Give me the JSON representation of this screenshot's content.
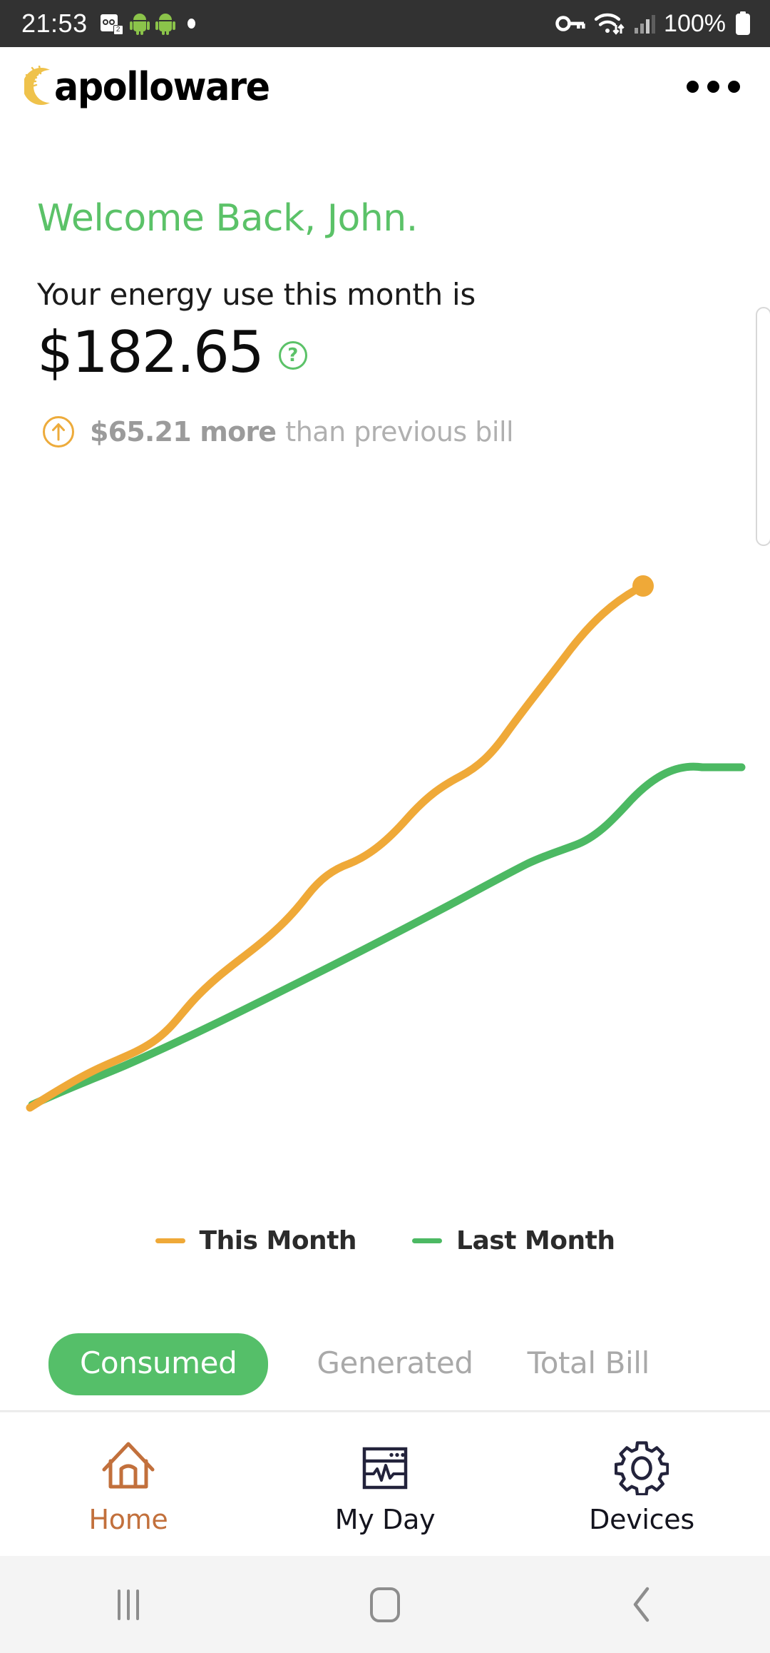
{
  "status_bar": {
    "time": "21:53",
    "voicemail_badge": "2",
    "left_icons": [
      "voicemail-icon",
      "android-icon",
      "android-icon",
      "dot-icon"
    ],
    "right_icons": [
      "vpn-key-icon",
      "wifi-icon",
      "signal-bars-icon",
      "battery-icon"
    ],
    "battery_percent": "100%"
  },
  "header": {
    "brand": "apolloware",
    "menu_icon": "kebab-menu-icon"
  },
  "hero": {
    "welcome": "Welcome Back, John.",
    "subtitle": "Your energy use this month is",
    "amount": "$182.65",
    "help_glyph": "?",
    "delta_strong": "$65.21 more",
    "delta_rest": "than previous bill",
    "delta_direction": "up"
  },
  "colors": {
    "green": "#5BC268",
    "green_pill": "#55BF69",
    "orange": "#EDAB3B",
    "line_orange": "#EFA938",
    "line_green": "#4CB963",
    "gray_text": "#a9a9a9",
    "home_active": "#C2703C",
    "nav_dark": "#14141e"
  },
  "chart_data": {
    "type": "line",
    "title": "",
    "xlabel": "",
    "ylabel": "",
    "grid": false,
    "legend_position": "bottom",
    "x": [
      0,
      1,
      2,
      3,
      4,
      5,
      6,
      7,
      8,
      9,
      10,
      11,
      12
    ],
    "series": [
      {
        "name": "This Month",
        "color": "#EFA938",
        "end_marker": true,
        "values": [
          2,
          10,
          22,
          29,
          38,
          46,
          55,
          64,
          70,
          78,
          86,
          95,
          100
        ]
      },
      {
        "name": "Last Month",
        "color": "#4CB963",
        "end_marker": false,
        "values": [
          2,
          9,
          18,
          25,
          32,
          38,
          45,
          51,
          56,
          63,
          72,
          79,
          80
        ]
      }
    ],
    "ylim": [
      0,
      105
    ],
    "xlim": [
      0,
      12
    ]
  },
  "legend": [
    {
      "label": "This Month",
      "color": "#EFA938"
    },
    {
      "label": "Last Month",
      "color": "#4CB963"
    }
  ],
  "tabs": [
    {
      "label": "Consumed",
      "active": true
    },
    {
      "label": "Generated",
      "active": false
    },
    {
      "label": "Total Bill",
      "active": false
    }
  ],
  "bottom_nav": [
    {
      "label": "Home",
      "icon": "house-icon",
      "active": true
    },
    {
      "label": "My Day",
      "icon": "window-chart-icon",
      "active": false
    },
    {
      "label": "Devices",
      "icon": "gear-icon",
      "active": false
    }
  ],
  "system_nav": {
    "recents": "recents-icon",
    "home": "home-square-icon",
    "back": "back-chevron-icon"
  }
}
